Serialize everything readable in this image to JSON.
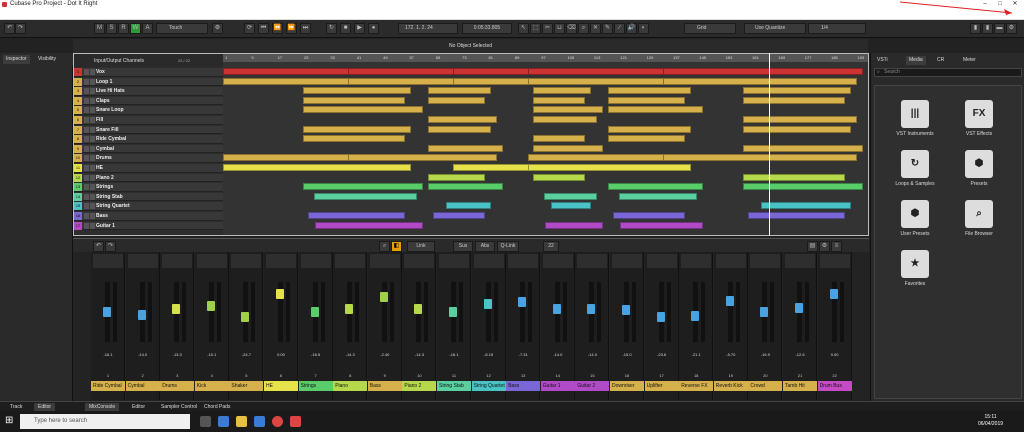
{
  "window": {
    "title": "Cubase Pro Project - Dot It Right"
  },
  "toolbar": {
    "msrw": [
      "M",
      "S",
      "R",
      "W",
      "A"
    ],
    "automation_mode": "Touch",
    "position": "172. 1. 2. 24",
    "time": "0:05:33.805",
    "grid_label": "Grid",
    "quantize_label": "Use Quantize",
    "quantize_value": "1/4"
  },
  "infobar": {
    "text": "No Object Selected"
  },
  "left_tabs": {
    "inspector": "Inspector",
    "visibility": "Visibility"
  },
  "tracklist": {
    "header": "Input/Output Channels",
    "counter": "22 / 22",
    "tracks": [
      {
        "num": "1",
        "name": "Vox",
        "color": "#c33"
      },
      {
        "num": "2",
        "name": "Loop 1",
        "color": "#d6b04a"
      },
      {
        "num": "3",
        "name": "Live Hi Hats",
        "color": "#d6b04a"
      },
      {
        "num": "4",
        "name": "Claps",
        "color": "#d6b04a"
      },
      {
        "num": "5",
        "name": "Snare Loop",
        "color": "#d6b04a"
      },
      {
        "num": "6",
        "name": "Fill",
        "color": "#d6b04a"
      },
      {
        "num": "7",
        "name": "Snare Fill",
        "color": "#d6b04a"
      },
      {
        "num": "8",
        "name": "Ride Cymbal",
        "color": "#d6b04a"
      },
      {
        "num": "9",
        "name": "Cymbal",
        "color": "#d6b04a"
      },
      {
        "num": "10",
        "name": "Drums",
        "color": "#d6b04a"
      },
      {
        "num": "11",
        "name": "HE",
        "color": "#e6e34a"
      },
      {
        "num": "12",
        "name": "Piano 2",
        "color": "#b5d94a"
      },
      {
        "num": "13",
        "name": "Strings",
        "color": "#5acc6a"
      },
      {
        "num": "14",
        "name": "String Stab",
        "color": "#5ad0a0"
      },
      {
        "num": "15",
        "name": "String Quartet",
        "color": "#4ac3c6"
      },
      {
        "num": "16",
        "name": "Bass",
        "color": "#7a66d6"
      },
      {
        "num": "17",
        "name": "Guitar 1",
        "color": "#b04ac6"
      }
    ]
  },
  "ruler": {
    "ticks": [
      "1",
      "9",
      "17",
      "25",
      "33",
      "41",
      "49",
      "57",
      "65",
      "73",
      "81",
      "89",
      "97",
      "105",
      "113",
      "121",
      "129",
      "137",
      "145",
      "153",
      "161",
      "169",
      "177",
      "185",
      "193"
    ]
  },
  "mixer": {
    "header": {
      "link": "Link",
      "sus": "Sus",
      "abs": "Abs",
      "qlink": "Q-Link",
      "count": "22"
    },
    "channels": [
      {
        "num": "1",
        "name": "Ride Cymbal",
        "val": "-16.1",
        "color": "#d6b04a",
        "fader": 0.55,
        "fc": "#4aa3e0"
      },
      {
        "num": "2",
        "name": "Cymbal",
        "val": "-14.0",
        "color": "#d6b04a",
        "fader": 0.5,
        "fc": "#4aa3e0"
      },
      {
        "num": "3",
        "name": "Drums",
        "val": "-13.3",
        "color": "#d6b04a",
        "fader": 0.6,
        "fc": "#d6e04a"
      },
      {
        "num": "4",
        "name": "Kick",
        "val": "-10.1",
        "color": "#d6b04a",
        "fader": 0.65,
        "fc": "#a0d04a"
      },
      {
        "num": "5",
        "name": "Shaker",
        "val": "-24.7",
        "color": "#d6b04a",
        "fader": 0.45,
        "fc": "#a0d04a"
      },
      {
        "num": "6",
        "name": "HE",
        "val": "0.00",
        "color": "#e6e34a",
        "fader": 0.88,
        "fc": "#e6e34a"
      },
      {
        "num": "7",
        "name": "Strings",
        "val": "-16.5",
        "color": "#5acc6a",
        "fader": 0.55,
        "fc": "#5acc6a"
      },
      {
        "num": "8",
        "name": "Piano",
        "val": "-14.3",
        "color": "#b5d94a",
        "fader": 0.6,
        "fc": "#b5d94a"
      },
      {
        "num": "9",
        "name": "Bass",
        "val": "-2.40",
        "color": "#d6b04a",
        "fader": 0.82,
        "fc": "#a0d04a"
      },
      {
        "num": "10",
        "name": "Piano 2",
        "val": "-14.3",
        "color": "#b5d94a",
        "fader": 0.6,
        "fc": "#b5d94a"
      },
      {
        "num": "11",
        "name": "String Stab",
        "val": "-16.1",
        "color": "#5ad0a0",
        "fader": 0.55,
        "fc": "#5ad0a0"
      },
      {
        "num": "12",
        "name": "String Quartet",
        "val": "-8.15",
        "color": "#4ac3c6",
        "fader": 0.7,
        "fc": "#4ac3c6"
      },
      {
        "num": "13",
        "name": "Bass",
        "val": "-7.31",
        "color": "#7a66d6",
        "fader": 0.72,
        "fc": "#4aa3e0"
      },
      {
        "num": "14",
        "name": "Guitar 1",
        "val": "-14.0",
        "color": "#b04ac6",
        "fader": 0.6,
        "fc": "#4aa3e0"
      },
      {
        "num": "15",
        "name": "Guitar 2",
        "val": "-14.0",
        "color": "#b04ac6",
        "fader": 0.6,
        "fc": "#4aa3e0"
      },
      {
        "num": "16",
        "name": "Downriser",
        "val": "-15.0",
        "color": "#d6b04a",
        "fader": 0.58,
        "fc": "#4aa3e0"
      },
      {
        "num": "17",
        "name": "Uplifter",
        "val": "-23.6",
        "color": "#d6b04a",
        "fader": 0.45,
        "fc": "#4aa3e0"
      },
      {
        "num": "18",
        "name": "Reverse FX",
        "val": "-21.1",
        "color": "#d6b04a",
        "fader": 0.48,
        "fc": "#4aa3e0"
      },
      {
        "num": "19",
        "name": "Reverb Kick",
        "val": "-5.70",
        "color": "#d6b04a",
        "fader": 0.75,
        "fc": "#4aa3e0"
      },
      {
        "num": "20",
        "name": "Crowd",
        "val": "-16.9",
        "color": "#d6b04a",
        "fader": 0.55,
        "fc": "#4aa3e0"
      },
      {
        "num": "21",
        "name": "Tamb Hit",
        "val": "-12.6",
        "color": "#d6b04a",
        "fader": 0.62,
        "fc": "#4aa3e0"
      },
      {
        "num": "22",
        "name": "Drum Bus",
        "val": "0.00",
        "color": "#c64ac6",
        "fader": 0.88,
        "fc": "#4aa3e0"
      }
    ]
  },
  "right_panel": {
    "tabs": [
      "VSTi",
      "Media",
      "CR",
      "Meter"
    ],
    "search_placeholder": "Search",
    "items": [
      {
        "label": "VST Instruments",
        "icon": "piano-icon",
        "glyph": "|||"
      },
      {
        "label": "VST Effects",
        "icon": "fx-icon",
        "glyph": "FX"
      },
      {
        "label": "Loops & Samples",
        "icon": "loop-icon",
        "glyph": "↻"
      },
      {
        "label": "Presets",
        "icon": "presets-icon",
        "glyph": "⬢"
      },
      {
        "label": "User Presets",
        "icon": "user-presets-icon",
        "glyph": "⬢"
      },
      {
        "label": "File Browser",
        "icon": "file-browser-icon",
        "glyph": "⌕"
      },
      {
        "label": "Favorites",
        "icon": "star-icon",
        "glyph": "★"
      }
    ]
  },
  "bottom_tabs": {
    "left": [
      "Track",
      "Editor"
    ],
    "right": [
      "MixConsole",
      "Editor",
      "Sampler Control",
      "Chord Pads"
    ]
  },
  "taskbar": {
    "search": "Type here to search",
    "time": "15:11",
    "date": "06/04/2019"
  }
}
